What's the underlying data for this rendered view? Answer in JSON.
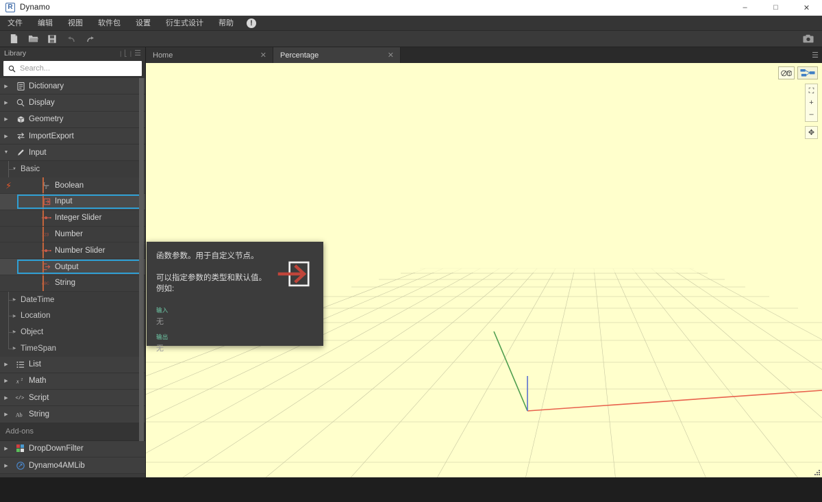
{
  "window": {
    "title": "Dynamo",
    "logo_letter": "R",
    "controls": {
      "minimize": "–",
      "maximize": "□",
      "close": "✕"
    }
  },
  "menubar": {
    "items": [
      {
        "label": "文件",
        "name": "menu-file"
      },
      {
        "label": "编辑",
        "name": "menu-edit"
      },
      {
        "label": "视图",
        "name": "menu-view"
      },
      {
        "label": "软件包",
        "name": "menu-packages"
      },
      {
        "label": "设置",
        "name": "menu-settings"
      },
      {
        "label": "衍生式设计",
        "name": "menu-generative-design"
      },
      {
        "label": "帮助",
        "name": "menu-help"
      }
    ],
    "alert_glyph": "!"
  },
  "toolbar": {
    "buttons": [
      {
        "name": "new-file-button",
        "icon": "new-file-icon"
      },
      {
        "name": "open-file-button",
        "icon": "folder-open-icon"
      },
      {
        "name": "save-button",
        "icon": "save-icon"
      },
      {
        "name": "undo-button",
        "icon": "undo-icon"
      },
      {
        "name": "redo-button",
        "icon": "redo-icon"
      }
    ],
    "screenshot_button": {
      "name": "screenshot-button",
      "icon": "camera-icon"
    }
  },
  "library": {
    "header_title": "Library",
    "search": {
      "placeholder": "Search...",
      "value": ""
    },
    "addons_title": "Add-ons",
    "tree": [
      {
        "label": "Dictionary",
        "icon": "book-icon",
        "level": 0,
        "expanded": false,
        "selected": false
      },
      {
        "label": "Display",
        "icon": "magnifier-icon",
        "level": 0,
        "expanded": false,
        "selected": false
      },
      {
        "label": "Geometry",
        "icon": "cube-icon",
        "level": 0,
        "expanded": false,
        "selected": false
      },
      {
        "label": "ImportExport",
        "icon": "arrows-exchange-icon",
        "level": 0,
        "expanded": false,
        "selected": false
      },
      {
        "label": "Input",
        "icon": "pencil-icon",
        "level": 0,
        "expanded": true,
        "selected": false
      },
      {
        "label": "Basic",
        "icon": "",
        "level": 1,
        "expanded": true,
        "selected": false
      },
      {
        "label": "Boolean",
        "icon": "boolean-icon",
        "level": 2,
        "selected": false
      },
      {
        "label": "Input",
        "icon": "input-node-icon",
        "level": 2,
        "selected": true
      },
      {
        "label": "Integer Slider",
        "icon": "slider-icon",
        "level": 2,
        "selected": false
      },
      {
        "label": "Number",
        "icon": "number-123-icon",
        "level": 2,
        "selected": false
      },
      {
        "label": "Number Slider",
        "icon": "slider-icon",
        "level": 2,
        "selected": false
      },
      {
        "label": "Output",
        "icon": "output-node-icon",
        "level": 2,
        "selected": true
      },
      {
        "label": "String",
        "icon": "abc-icon",
        "level": 2,
        "selected": false
      },
      {
        "label": "DateTime",
        "icon": "",
        "level": 1,
        "expanded": false,
        "selected": false
      },
      {
        "label": "Location",
        "icon": "",
        "level": 1,
        "expanded": false,
        "selected": false
      },
      {
        "label": "Object",
        "icon": "",
        "level": 1,
        "expanded": false,
        "selected": false
      },
      {
        "label": "TimeSpan",
        "icon": "",
        "level": 1,
        "expanded": false,
        "selected": false
      },
      {
        "label": "List",
        "icon": "list-icon",
        "level": 0,
        "expanded": false,
        "selected": false
      },
      {
        "label": "Math",
        "icon": "math-x2-icon",
        "level": 0,
        "expanded": false,
        "selected": false
      },
      {
        "label": "Script",
        "icon": "code-icon",
        "level": 0,
        "expanded": false,
        "selected": false
      },
      {
        "label": "String",
        "icon": "ab-icon",
        "level": 0,
        "expanded": false,
        "selected": false
      }
    ],
    "addons": [
      {
        "label": "DropDownFilter",
        "icon": "dropdownfilter-icon",
        "level": 0,
        "expanded": false
      },
      {
        "label": "Dynamo4AMLib",
        "icon": "dynamo4amlib-icon",
        "level": 0,
        "expanded": false
      }
    ]
  },
  "tabs": [
    {
      "label": "Home",
      "active": false,
      "close_glyph": "✕"
    },
    {
      "label": "Percentage",
      "active": true,
      "close_glyph": "✕"
    }
  ],
  "tooltip": {
    "line1": "函数参数。用于自定义节点。",
    "line2": "可以指定参数的类型和默认值。例如:",
    "icon": "input-node-icon",
    "sections": [
      {
        "title": "输入",
        "value": "无"
      },
      {
        "title": "输出",
        "value": "无"
      }
    ]
  },
  "viewport": {
    "background_color": "#ffffcc",
    "grid_color": "#c8c8a8",
    "axis_x_color": "#e8604c",
    "axis_y_color": "#4f9e4f",
    "axis_z_color": "#5a6fd0",
    "toggles": [
      {
        "name": "geometry-view-toggle",
        "icon": "geometry-view-icon",
        "active": false
      },
      {
        "name": "graph-view-toggle",
        "icon": "graph-view-icon",
        "active": true
      }
    ],
    "nav_buttons": [
      {
        "name": "zoom-to-fit-button",
        "icon": "zoom-to-fit-icon",
        "glyph": "⛶"
      },
      {
        "name": "zoom-in-button",
        "icon": "plus-icon",
        "glyph": "+"
      },
      {
        "name": "zoom-out-button",
        "icon": "minus-icon",
        "glyph": "–"
      }
    ],
    "pan_button": {
      "name": "pan-button",
      "icon": "pan-move-icon",
      "glyph": "✥"
    }
  },
  "colors": {
    "accent_selection": "#2f9fd4",
    "accent_orange": "#c4643c",
    "tooltip_bg": "#3c3c3c",
    "tooltip_label": "#6fcaa8"
  }
}
